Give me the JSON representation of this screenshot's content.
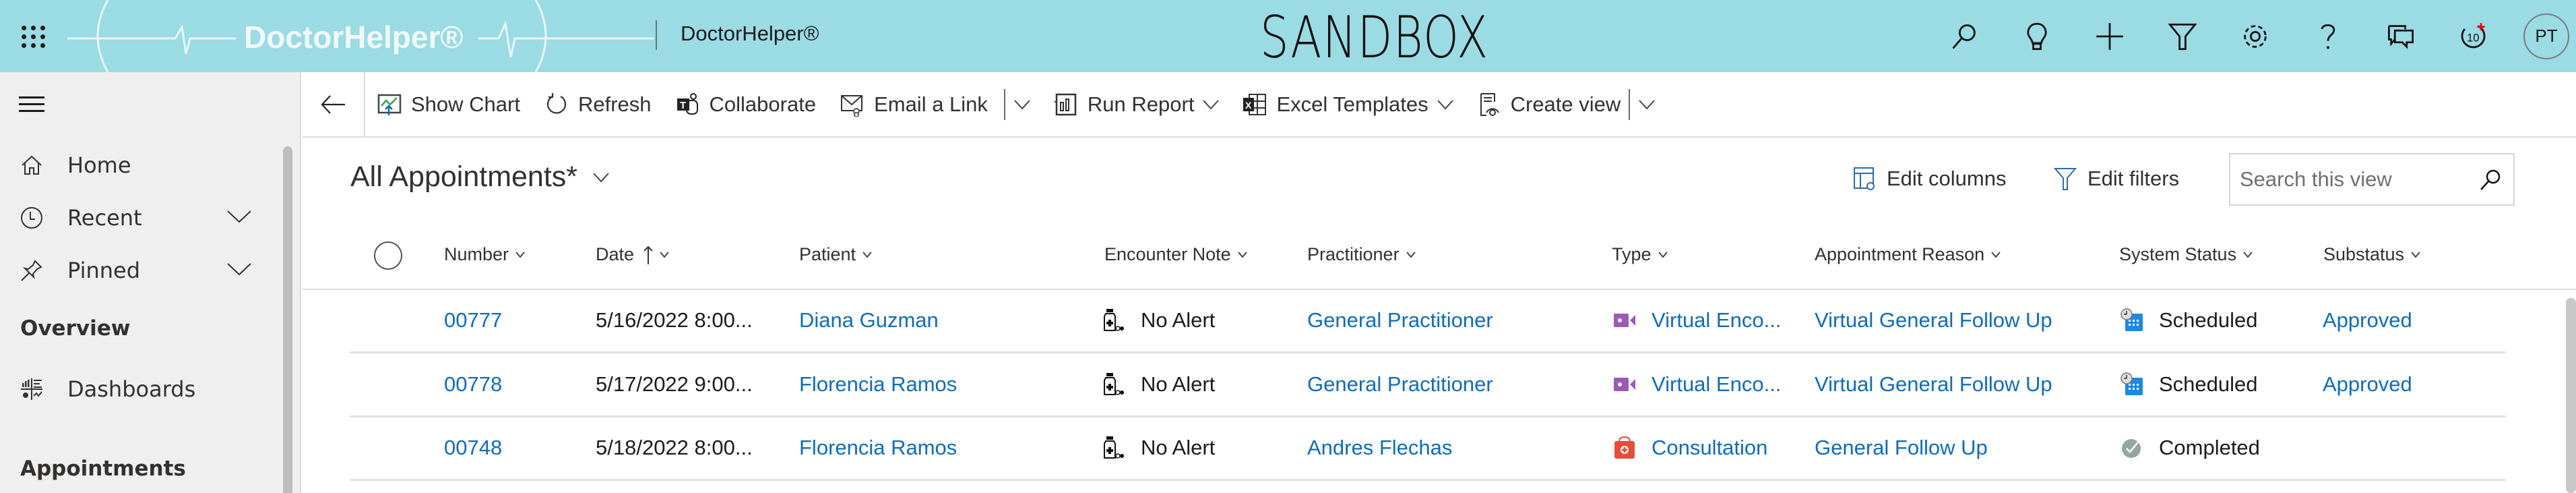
{
  "header": {
    "logo_text": "DoctorHelper®",
    "app_name": "DoctorHelper®",
    "environment_label": "SANDBOX",
    "icons": [
      "search-icon",
      "lightbulb-icon",
      "plus-icon",
      "filter-icon",
      "settings-icon",
      "help-icon",
      "chat-icon",
      "notifications-icon"
    ],
    "notification_badge": "10",
    "avatar_initials": "PT"
  },
  "sidebar": {
    "items": [
      {
        "label": "Home",
        "icon": "home-icon"
      },
      {
        "label": "Recent",
        "icon": "clock-icon",
        "expandable": true
      },
      {
        "label": "Pinned",
        "icon": "pin-icon",
        "expandable": true
      }
    ],
    "sections": [
      {
        "title": "Overview",
        "items": [
          {
            "label": "Dashboards",
            "icon": "dashboard-icon"
          }
        ]
      },
      {
        "title": "Appointments",
        "items": []
      }
    ]
  },
  "commandbar": {
    "show_chart": "Show Chart",
    "refresh": "Refresh",
    "collaborate": "Collaborate",
    "email_link": "Email a Link",
    "run_report": "Run Report",
    "excel_templates": "Excel Templates",
    "create_view": "Create view"
  },
  "view": {
    "title": "All Appointments*",
    "edit_columns": "Edit columns",
    "edit_filters": "Edit filters",
    "search_placeholder": "Search this view",
    "search_value": ""
  },
  "grid": {
    "columns": [
      "Number",
      "Date",
      "Patient",
      "Encounter Note",
      "Practitioner",
      "Type",
      "Appointment Reason",
      "System Status",
      "Substatus"
    ],
    "sorted_column": "Date",
    "sort_direction": "ascending",
    "rows": [
      {
        "number": "00777",
        "date": "5/16/2022 8:00...",
        "patient": "Diana Guzman",
        "encounter_note": "No Alert",
        "practitioner": "General Practitioner",
        "type": "Virtual Enco...",
        "type_icon": "video-icon",
        "reason": "Virtual General Follow Up",
        "status": "Scheduled",
        "status_icon": "calendar-clock-icon",
        "substatus": "Approved"
      },
      {
        "number": "00778",
        "date": "5/17/2022 9:00...",
        "patient": "Florencia Ramos",
        "encounter_note": "No Alert",
        "practitioner": "General Practitioner",
        "type": "Virtual Enco...",
        "type_icon": "video-icon",
        "reason": "Virtual General Follow Up",
        "status": "Scheduled",
        "status_icon": "calendar-clock-icon",
        "substatus": "Approved"
      },
      {
        "number": "00748",
        "date": "5/18/2022 8:00...",
        "patient": "Florencia Ramos",
        "encounter_note": "No Alert",
        "practitioner": "Andres Flechas",
        "type": "Consultation",
        "type_icon": "medical-kit-icon",
        "reason": "General Follow Up",
        "status": "Completed",
        "status_icon": "check-circle-icon",
        "substatus": ""
      }
    ]
  },
  "colors": {
    "header_bg": "#9bdbe3",
    "link": "#0f6cbd",
    "sidebar_bg": "#efefef",
    "virtual_type": "#9b59b6",
    "consultation_type": "#e74c3c",
    "scheduled_icon": "#1e88e5",
    "completed_icon": "#95a5a6"
  }
}
